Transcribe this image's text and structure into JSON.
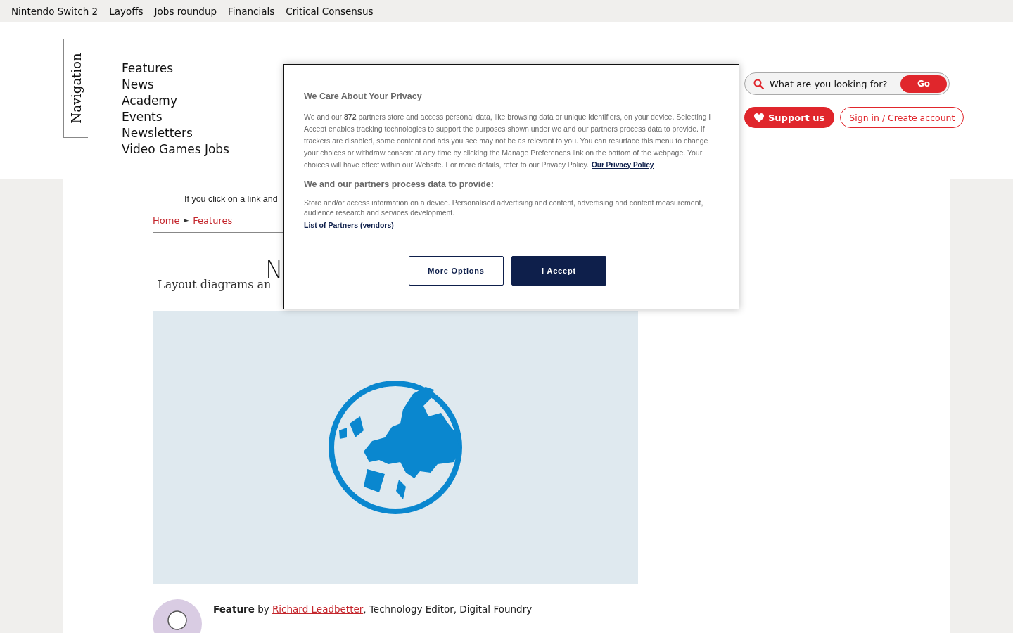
{
  "top_links": [
    "Nintendo Switch 2",
    "Layoffs",
    "Jobs roundup",
    "Financials",
    "Critical Consensus"
  ],
  "navigation": {
    "label": "Navigation",
    "items": [
      "Features",
      "News",
      "Academy",
      "Events",
      "Newsletters",
      "Video Games Jobs"
    ]
  },
  "search": {
    "placeholder": "What are you looking for?",
    "button": "Go"
  },
  "support_button": "Support us",
  "signin_button": "Sign in / Create account",
  "affiliate_notice": "If you click on a link and",
  "breadcrumb": {
    "separator": "►",
    "items": [
      "Home",
      "Features"
    ]
  },
  "headline": "N",
  "subheadline": "Layout diagrams an",
  "byline": {
    "type": "Feature",
    "by": "by",
    "author": "Richard Leadbetter",
    "role": ", Technology Editor, Digital Foundry"
  },
  "consent": {
    "title": "We Care About Your Privacy",
    "body": "We and our **872** partners store and access personal data, like browsing data or unique identifiers, on your device. Selecting I Accept enables tracking technologies to support the purposes shown under we and our partners process data to provide. If trackers are disabled, some content and ads you see may not be as relevant to you. You can resurface this menu to change your choices or withdraw consent at any time by clicking the Manage Preferences link on the bottom of the webpage. Your choices will have effect within our Website. For more details, refer to our Privacy Policy.",
    "policy_link": "Our Privacy Policy",
    "subtitle": "We and our partners process data to provide:",
    "purposes": "Store and/or access information on a device. Personalised advertising and content, advertising and content measurement, audience research and services development.",
    "partners_link": "List of Partners (vendors)",
    "buttons": [
      {
        "label": "More Options",
        "kind": "secondary"
      },
      {
        "label": "I Accept",
        "kind": "primary"
      }
    ]
  }
}
